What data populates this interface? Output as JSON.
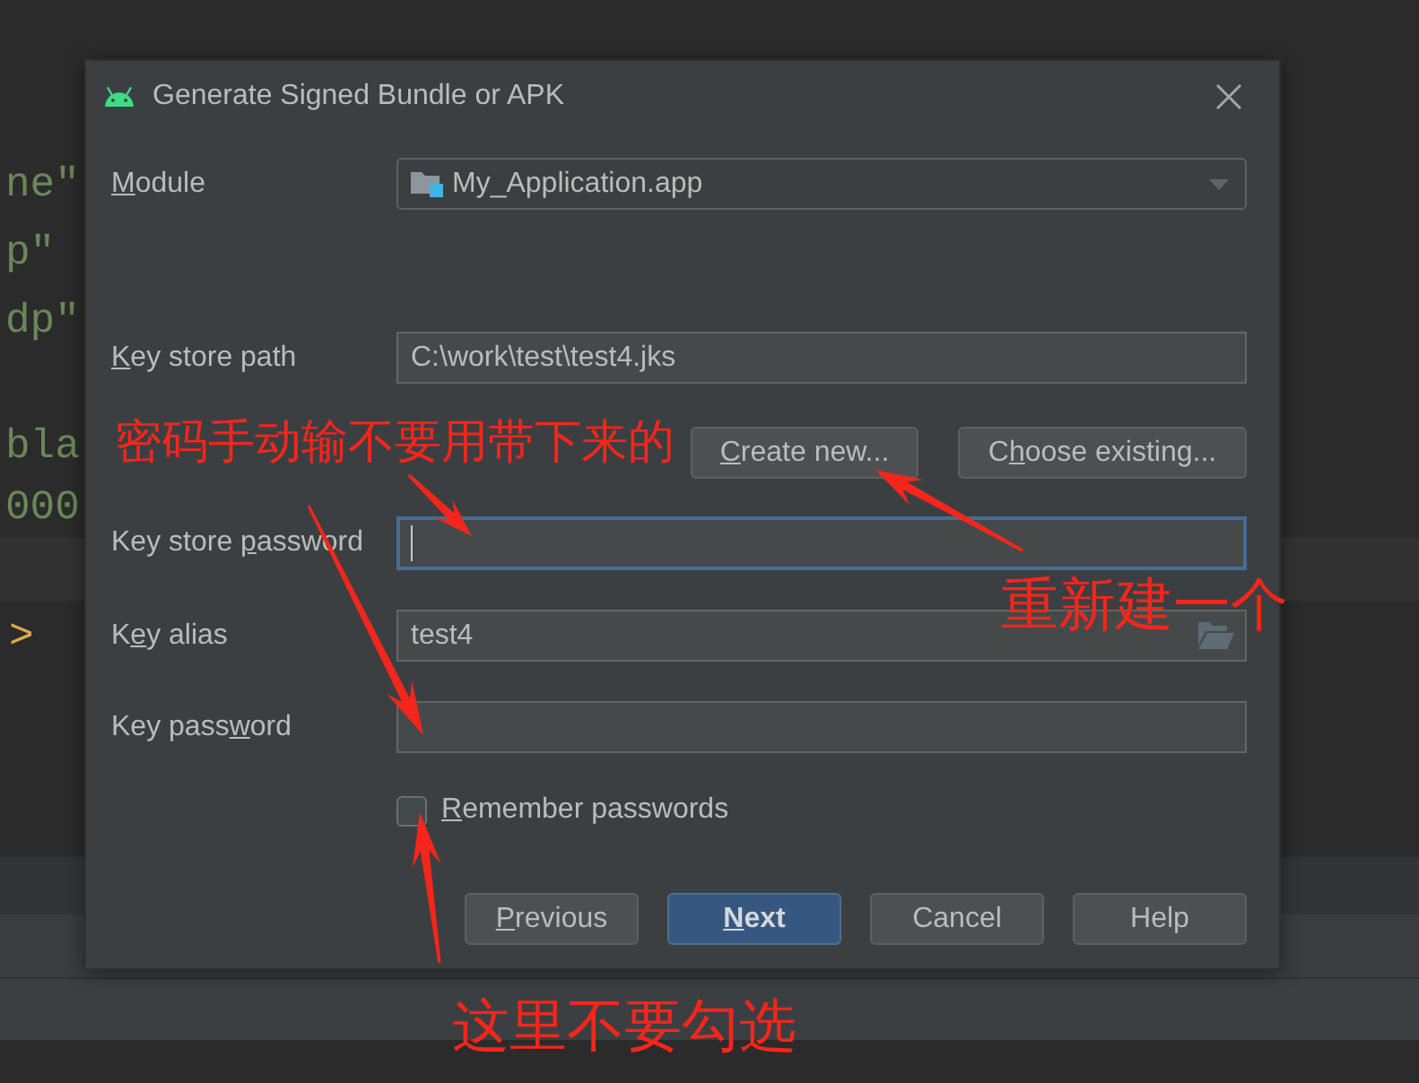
{
  "editor": {
    "code_lines": [
      "ne\"",
      "p\"",
      "dp\"",
      "bla",
      "000"
    ],
    "code_line_below": ">"
  },
  "dialog": {
    "title": "Generate Signed Bundle or APK",
    "module": {
      "label": {
        "mnemonic": "M",
        "post": "odule"
      },
      "value": "My_Application.app"
    },
    "key_store_path": {
      "label": {
        "mnemonic": "K",
        "post": "ey store path"
      },
      "value": "C:\\work\\test\\test4.jks"
    },
    "key_store_buttons": [
      {
        "label": {
          "mnemonic": "C",
          "post": "reate new..."
        }
      },
      {
        "label": {
          "pre": "C",
          "mnemonic": "h",
          "post": "oose existing..."
        }
      }
    ],
    "fields": [
      {
        "kind": "password",
        "label": {
          "pre": "Key store ",
          "mnemonic": "p",
          "post": "assword"
        },
        "focused": true
      },
      {
        "kind": "browse",
        "label": {
          "pre": "K",
          "mnemonic": "e",
          "post": "y alias"
        },
        "value": "test4",
        "focused": false
      },
      {
        "kind": "password",
        "label": {
          "pre": "Key pass",
          "mnemonic": "w",
          "post": "ord"
        },
        "focused": false
      }
    ],
    "remember_passwords": {
      "label": {
        "mnemonic": "R",
        "post": "emember passwords"
      },
      "checked": false
    },
    "buttons": [
      {
        "label": {
          "mnemonic": "P",
          "post": "revious"
        },
        "default": false
      },
      {
        "label": {
          "mnemonic": "N",
          "post": "ext"
        },
        "default": true
      },
      {
        "label": {
          "pre": "Cancel"
        },
        "default": false
      },
      {
        "label": {
          "pre": "Help"
        },
        "default": false
      }
    ]
  },
  "annotations": [
    {
      "text": "密码手动输不要用带下来的"
    },
    {
      "text": "重新建一个"
    },
    {
      "text": "这里不要勾选"
    }
  ]
}
